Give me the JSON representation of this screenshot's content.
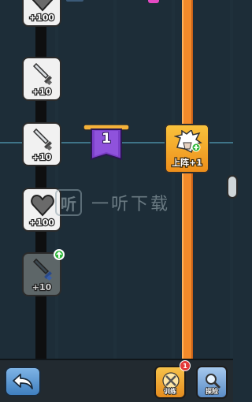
{
  "path": {
    "tiles": [
      {
        "name": "heart-tile",
        "icon": "heart-icon",
        "label": "+100",
        "locked": false
      },
      {
        "name": "sword-tile",
        "icon": "sword-icon",
        "label": "+10",
        "locked": false
      },
      {
        "name": "sword-tile",
        "icon": "sword-icon",
        "label": "+10",
        "locked": false
      },
      {
        "name": "heart-tile",
        "icon": "heart-icon",
        "label": "+100",
        "locked": false
      },
      {
        "name": "sword-tile-locked",
        "icon": "sword-icon",
        "label": "+10",
        "locked": true
      }
    ],
    "level_banner": "1",
    "reward_card": {
      "label": "上阵+1",
      "icon": "white-hair-hero-icon"
    }
  },
  "watermark": {
    "logo": "听",
    "text": "一听下载"
  },
  "bottom_nav": {
    "back_icon": "back-arrow-icon",
    "train_label": "训练",
    "train_badge": "1",
    "explore_label": "探险"
  },
  "colors": {
    "background": "#1d2d38",
    "left_track": "#0e0f10",
    "right_track": "#f28a2a",
    "banner": "#7b3fc8",
    "reward": "#f2a62a"
  }
}
